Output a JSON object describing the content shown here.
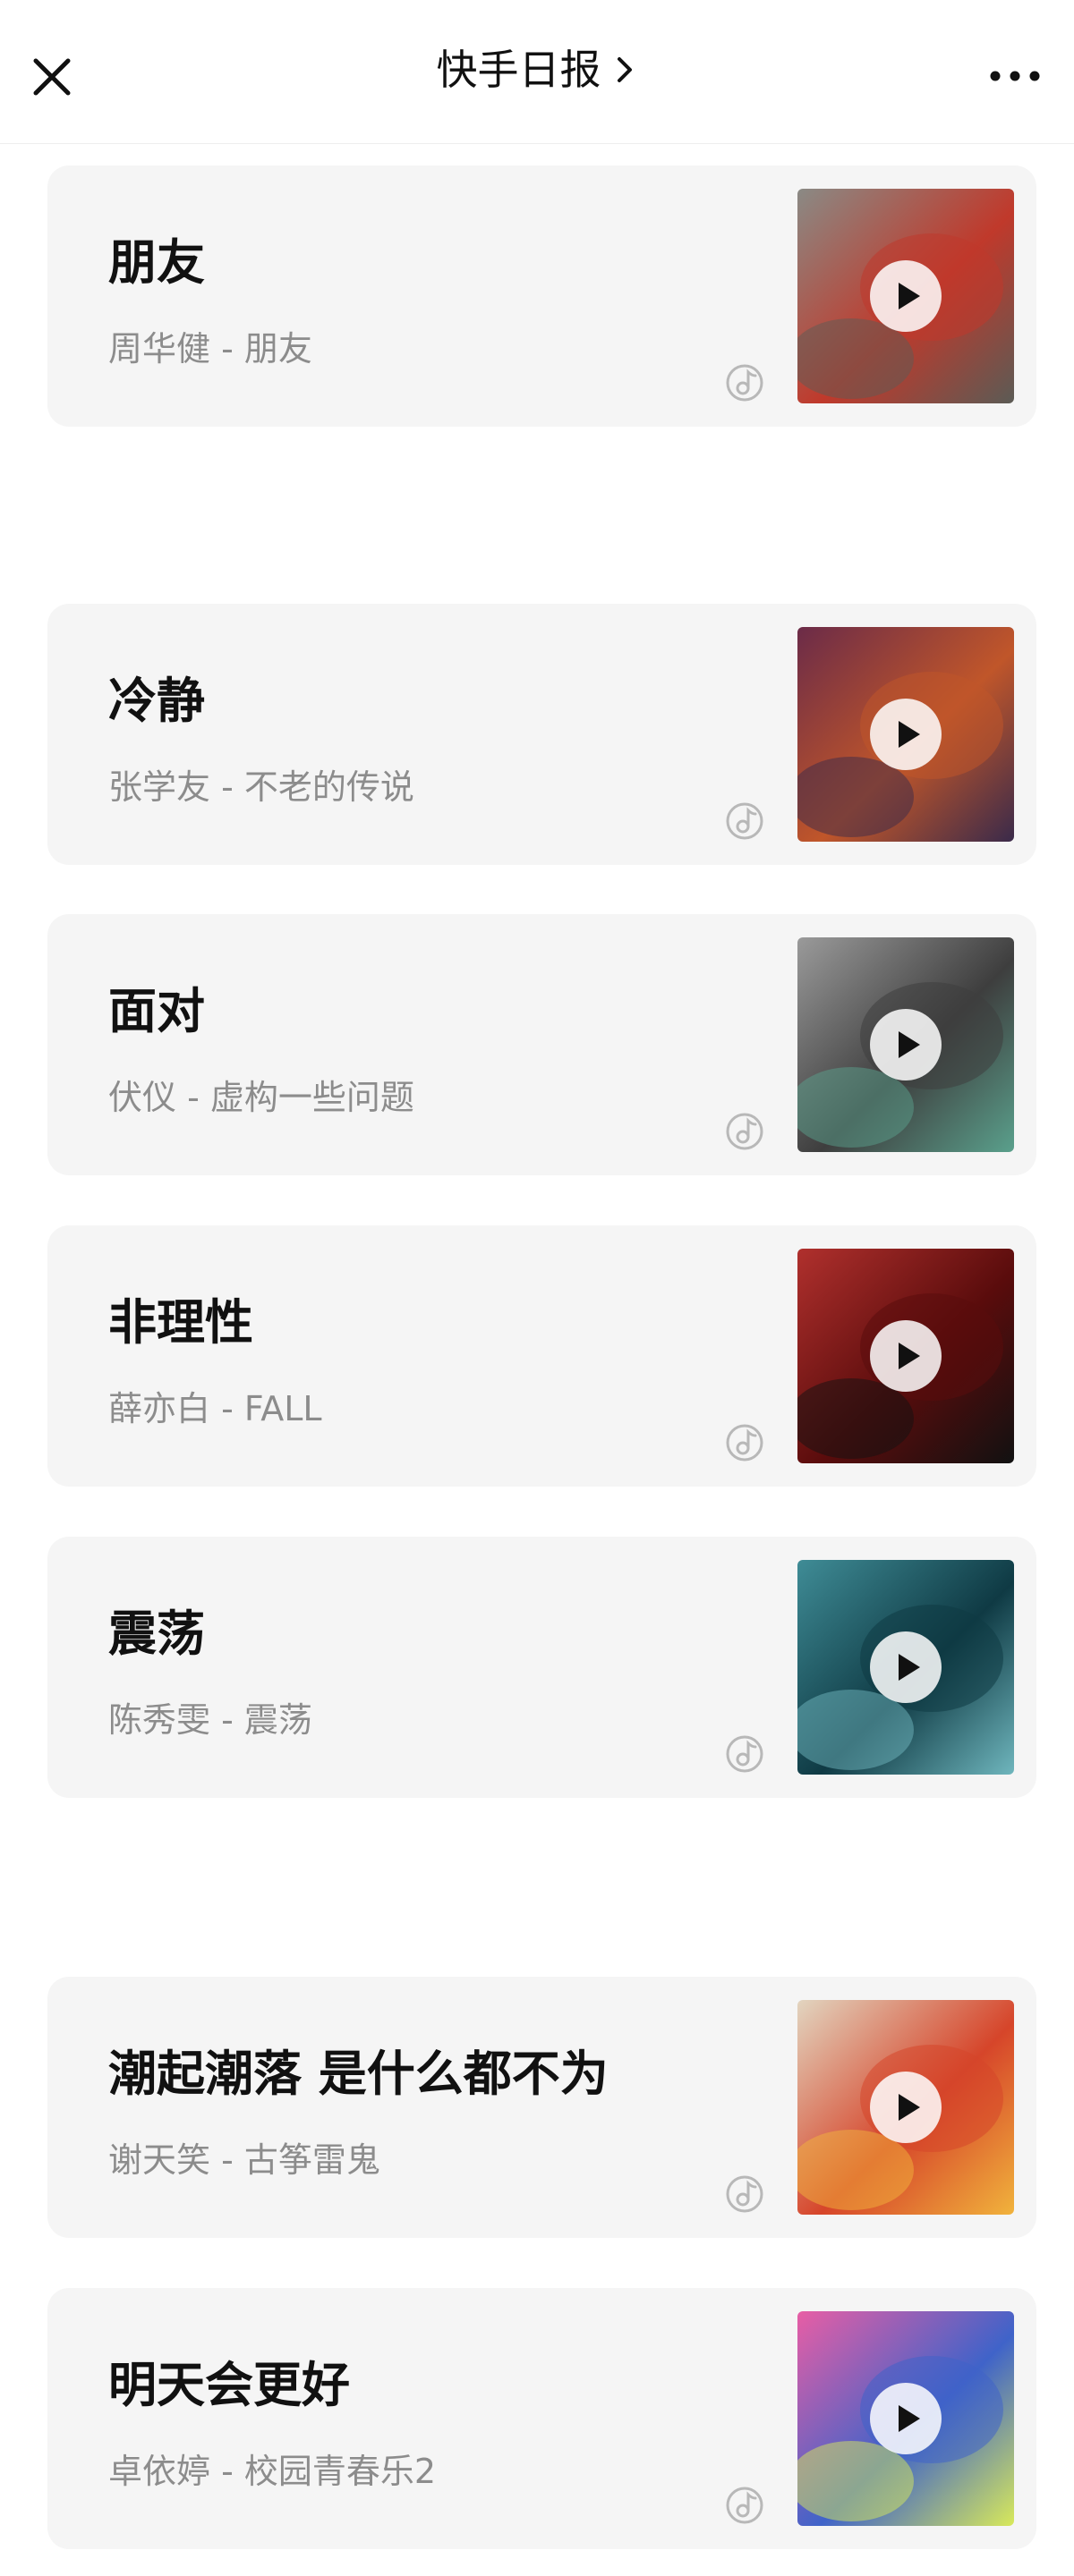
{
  "header": {
    "title": "快手日报"
  },
  "songs": [
    {
      "title": "朋友",
      "subtitle": "周华健 - 朋友",
      "cover_colors": [
        "#8a8a85",
        "#c0392b",
        "#5b5b55"
      ]
    },
    {
      "title": "冷静",
      "subtitle": "张学友 - 不老的传说",
      "cover_colors": [
        "#6b2b48",
        "#c0562a",
        "#3a2a4a"
      ]
    },
    {
      "title": "面对",
      "subtitle": "伏仪 - 虚构一些问题",
      "cover_colors": [
        "#9a9a9a",
        "#3e3e3e",
        "#5aa08c"
      ]
    },
    {
      "title": "非理性",
      "subtitle": "薛亦白 - FALL",
      "cover_colors": [
        "#b0302d",
        "#5a0c0c",
        "#111111"
      ]
    },
    {
      "title": "震荡",
      "subtitle": "陈秀雯 - 震荡",
      "cover_colors": [
        "#3f8c96",
        "#0f3a44",
        "#6fb6bd"
      ]
    },
    {
      "title": "潮起潮落 是什么都不为",
      "subtitle": "谢天笑 - 古筝雷鬼",
      "cover_colors": [
        "#e2d5c0",
        "#d6452a",
        "#f1b33c"
      ]
    },
    {
      "title": "明天会更好",
      "subtitle": "卓依婷 - 校园青春乐2",
      "cover_colors": [
        "#e85ea5",
        "#3f63c9",
        "#d8e95a"
      ]
    }
  ]
}
